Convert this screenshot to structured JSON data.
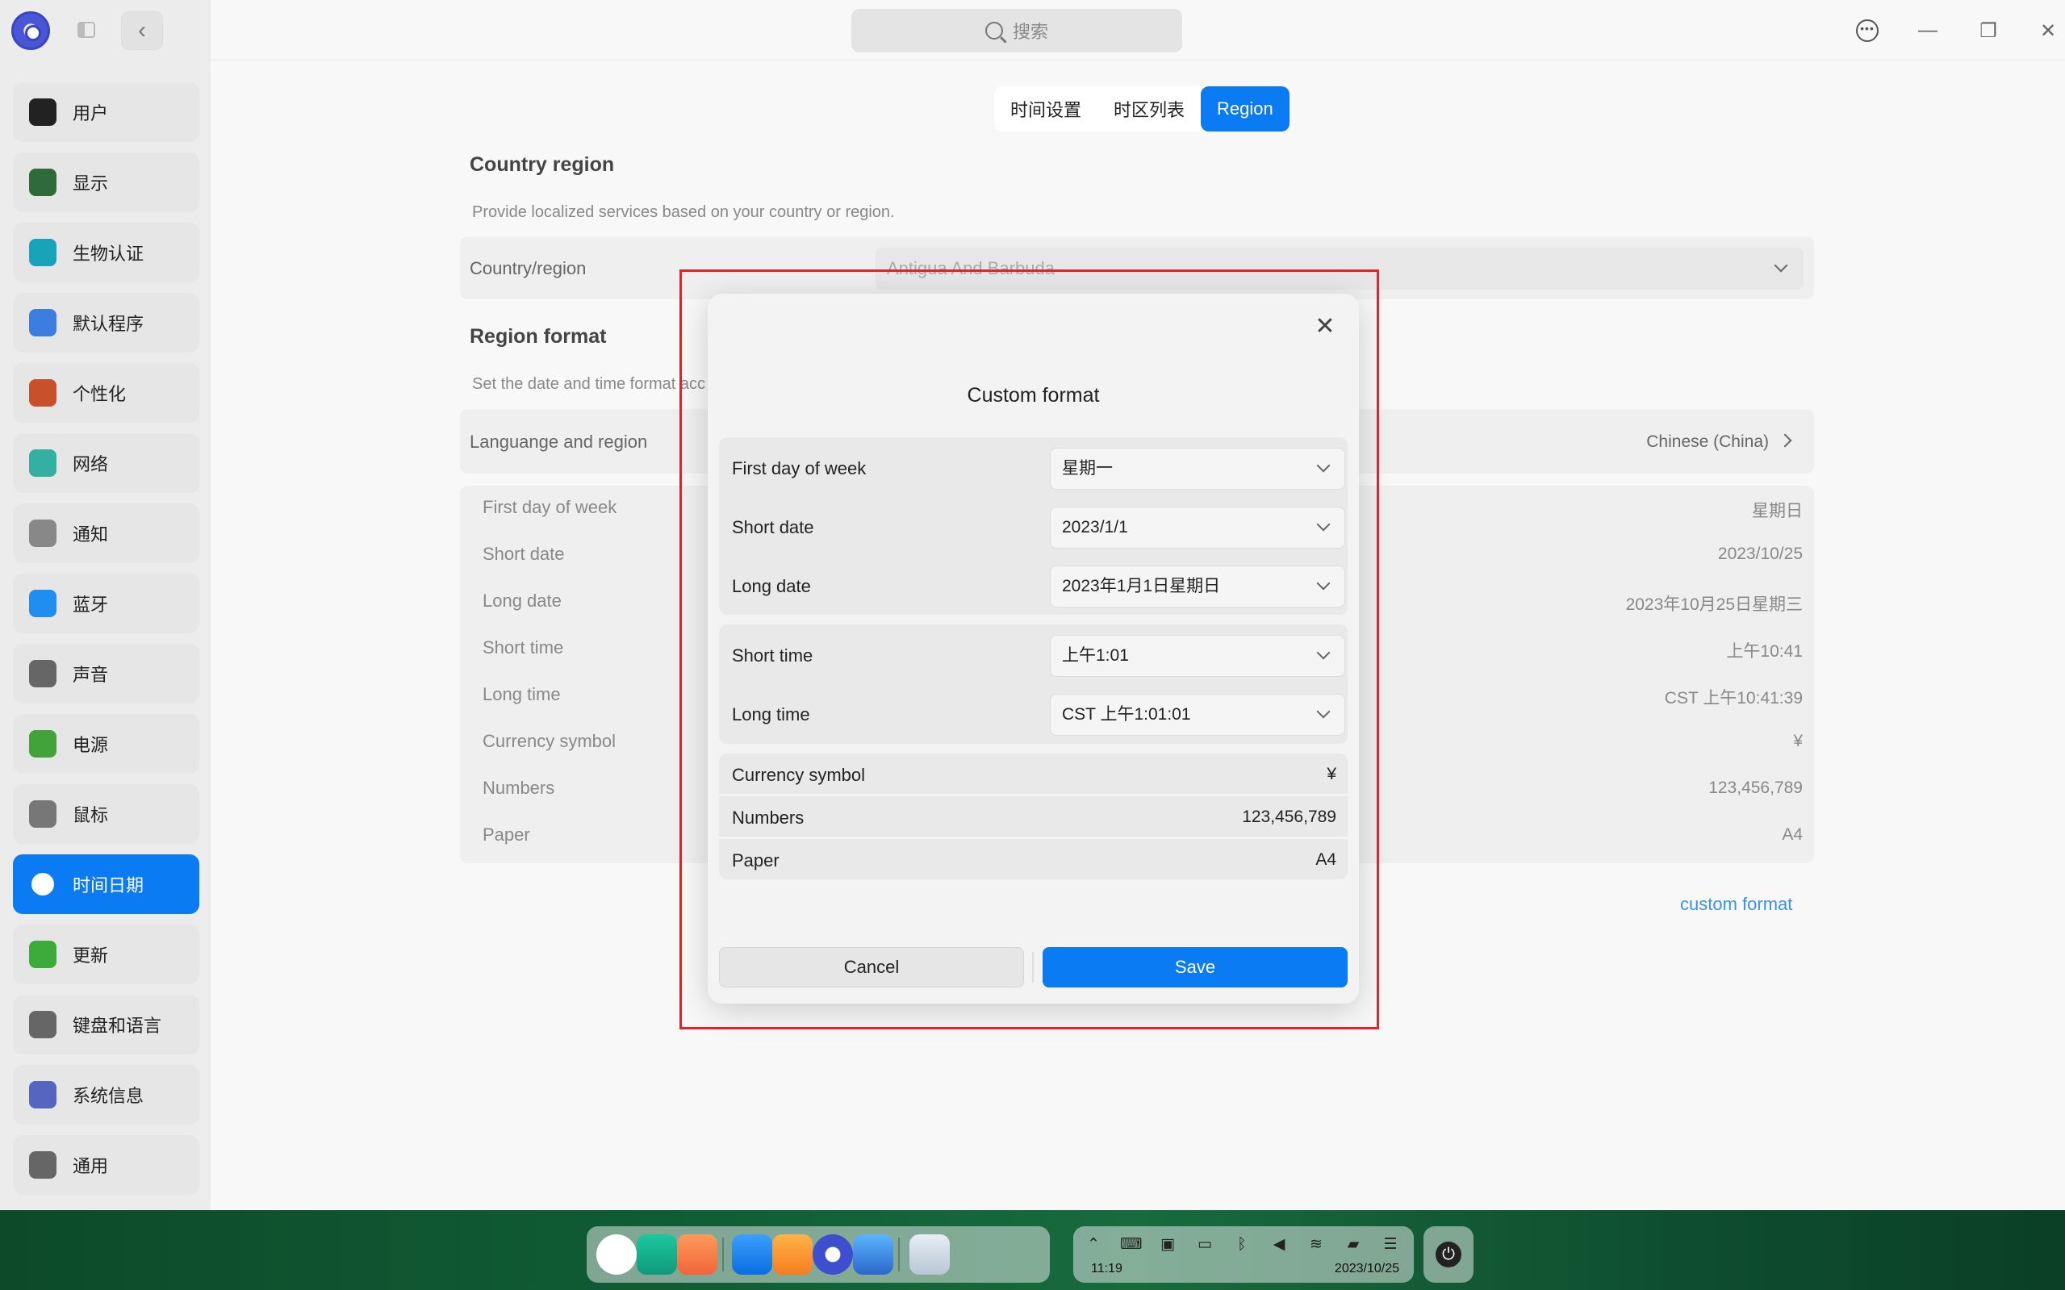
{
  "search": {
    "placeholder": "搜索"
  },
  "sidebar": {
    "items": [
      {
        "label": "用户",
        "icon": "user-icon",
        "color": "#222222"
      },
      {
        "label": "显示",
        "icon": "display-icon",
        "color": "#2f6a3a"
      },
      {
        "label": "生物认证",
        "icon": "fingerprint-icon",
        "color": "#17a3b8"
      },
      {
        "label": "默认程序",
        "icon": "default-apps-icon",
        "color": "#3d7de0"
      },
      {
        "label": "个性化",
        "icon": "palette-icon",
        "color": "#c8502a"
      },
      {
        "label": "网络",
        "icon": "network-icon",
        "color": "#34b0a0"
      },
      {
        "label": "通知",
        "icon": "bell-icon",
        "color": "#888888"
      },
      {
        "label": "蓝牙",
        "icon": "bluetooth-icon",
        "color": "#1f8ef0"
      },
      {
        "label": "声音",
        "icon": "speaker-icon",
        "color": "#666666"
      },
      {
        "label": "电源",
        "icon": "battery-icon",
        "color": "#43a33b"
      },
      {
        "label": "鼠标",
        "icon": "mouse-icon",
        "color": "#777777"
      },
      {
        "label": "时间日期",
        "icon": "clock-icon",
        "color": "#ffffff",
        "active": true
      },
      {
        "label": "更新",
        "icon": "update-icon",
        "color": "#3cab3c"
      },
      {
        "label": "键盘和语言",
        "icon": "keyboard-icon",
        "color": "#666666"
      },
      {
        "label": "系统信息",
        "icon": "info-icon",
        "color": "#5565c0"
      },
      {
        "label": "通用",
        "icon": "general-icon",
        "color": "#666666"
      }
    ]
  },
  "tabs": [
    "时间设置",
    "时区列表",
    "Region"
  ],
  "country_region": {
    "title": "Country region",
    "subtitle": "Provide localized services based on your country or region.",
    "label": "Country/region",
    "value": "Antigua And Barbuda"
  },
  "region_format": {
    "title": "Region format",
    "subtitle": "Set the date and time format acc",
    "language_label": "Languange and region",
    "language_value": "Chinese (China)",
    "rows": [
      {
        "label": "First day of week",
        "value": "星期日"
      },
      {
        "label": "Short date",
        "value": "2023/10/25"
      },
      {
        "label": "Long date",
        "value": "2023年10月25日星期三"
      },
      {
        "label": "Short time",
        "value": "上午10:41"
      },
      {
        "label": "Long time",
        "value": "CST 上午10:41:39"
      },
      {
        "label": "Currency symbol",
        "value": "¥"
      },
      {
        "label": "Numbers",
        "value": "123,456,789"
      },
      {
        "label": "Paper",
        "value": "A4"
      }
    ],
    "custom_link": "custom format"
  },
  "dialog": {
    "title": "Custom format",
    "date_rows": [
      {
        "label": "First day of week",
        "value": "星期一"
      },
      {
        "label": "Short date",
        "value": "2023/1/1"
      },
      {
        "label": "Long date",
        "value": "2023年1月1日星期日"
      }
    ],
    "time_rows": [
      {
        "label": "Short time",
        "value": "上午1:01"
      },
      {
        "label": "Long time",
        "value": "CST 上午1:01:01"
      }
    ],
    "static_rows": [
      {
        "label": "Currency symbol",
        "value": "¥"
      },
      {
        "label": "Numbers",
        "value": "123,456,789"
      },
      {
        "label": "Paper",
        "value": "A4"
      }
    ],
    "cancel": "Cancel",
    "save": "Save"
  },
  "taskbar": {
    "time": "11:19",
    "date": "2023/10/25"
  },
  "colors": {
    "accent": "#0a7bf2",
    "highlight": "#e0242c",
    "link": "#3a92e8"
  }
}
